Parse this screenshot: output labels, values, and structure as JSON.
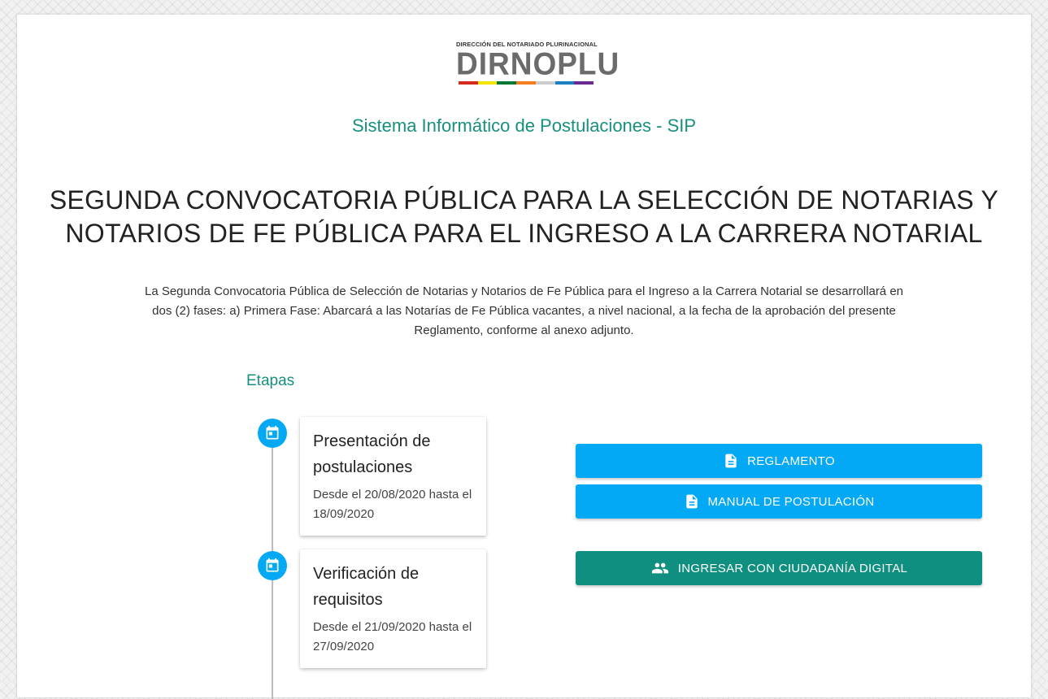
{
  "logo": {
    "top_text": "DIRECCIÓN DEL NOTARIADO PLURINACIONAL",
    "main_text": "DIRNOPLU",
    "bar_colors": [
      "#d52b1e",
      "#f4e400",
      "#007934",
      "#f47d20",
      "#ffffff",
      "#1d7fc2",
      "#6a2c91"
    ]
  },
  "header": {
    "subtitle": "Sistema Informático de Postulaciones - SIP",
    "title": "SEGUNDA CONVOCATORIA PÚBLICA PARA LA SELECCIÓN DE NOTARIAS Y NOTARIOS DE FE PÚBLICA PARA EL INGRESO A LA CARRERA NOTARIAL",
    "description": "La Segunda Convocatoria Pública de Selección de Notarias y Notarios de Fe Pública para el Ingreso a la Carrera Notarial se desarrollará en dos (2) fases: a) Primera Fase: Abarcará a las Notarías de Fe Pública vacantes, a nivel nacional, a la fecha de la aprobación del presente Reglamento, conforme al anexo adjunto."
  },
  "stages": {
    "heading": "Etapas",
    "items": [
      {
        "title": "Presentación de postulaciones",
        "dates": "Desde el 20/08/2020 hasta el 18/09/2020",
        "icon": "calendar-icon"
      },
      {
        "title": "Verificación de requisitos",
        "dates": "Desde el 21/09/2020 hasta el 27/09/2020",
        "icon": "calendar-icon"
      }
    ]
  },
  "actions": {
    "reglamento": "REGLAMENTO",
    "manual": "MANUAL DE POSTULACIÓN",
    "login": "INGRESAR CON CIUDADANÍA DIGITAL"
  },
  "colors": {
    "accent_teal": "#17907e",
    "button_blue": "#03a9f4",
    "button_green": "#0f8f7f"
  }
}
